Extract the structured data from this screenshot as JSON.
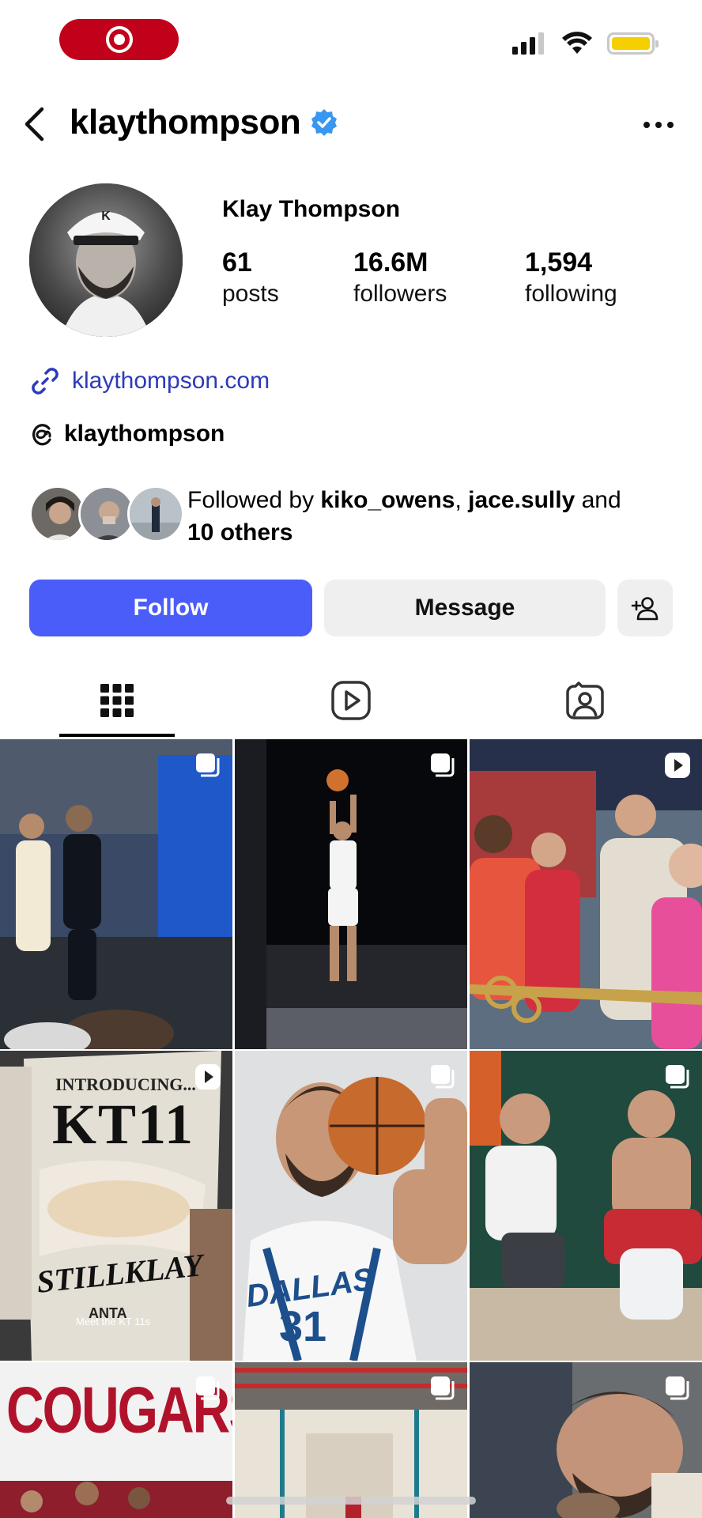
{
  "status_bar": {
    "icons": [
      "screen-record-icon",
      "signal-icon",
      "wifi-icon",
      "battery-icon"
    ]
  },
  "header": {
    "username": "klaythompson",
    "verified": true,
    "icons": [
      "back-icon",
      "verified-badge-icon",
      "more-icon"
    ]
  },
  "profile": {
    "display_name": "Klay Thompson",
    "stats": {
      "posts_count": "61",
      "posts_label": "posts",
      "followers_count": "16.6M",
      "followers_label": "followers",
      "following_count": "1,594",
      "following_label": "following"
    },
    "website": "klaythompson.com",
    "threads_handle": "klaythompson",
    "followed_by": {
      "prefix": "Followed by ",
      "user1": "kiko_owens",
      "sep": ", ",
      "user2": "jace.sully",
      "middle": " and",
      "others": "10 others"
    }
  },
  "actions": {
    "follow_label": "Follow",
    "message_label": "Message"
  },
  "tabs": [
    {
      "name": "posts",
      "icon": "grid-icon",
      "active": true
    },
    {
      "name": "reels",
      "icon": "reels-icon",
      "active": false
    },
    {
      "name": "tagged",
      "icon": "tagged-icon",
      "active": false
    }
  ],
  "grid": {
    "posts": [
      {
        "type": "carousel"
      },
      {
        "type": "carousel"
      },
      {
        "type": "video"
      },
      {
        "type": "video",
        "overlay_text": [
          "INTRODUCING...",
          "KT11",
          "STILLKLAY",
          "ANTA"
        ],
        "caption": "Meet the KT 11s"
      },
      {
        "type": "carousel",
        "overlay_text": [
          "DALLAS",
          "31"
        ]
      },
      {
        "type": "carousel"
      },
      {
        "type": "carousel",
        "overlay_text": [
          "COUGARS"
        ]
      },
      {
        "type": "carousel"
      },
      {
        "type": "carousel"
      }
    ]
  },
  "colors": {
    "follow_button": "#4a5df9",
    "link": "#2d3ab8",
    "verified": "#3897f0",
    "record_pill": "#c1001a",
    "battery": "#f5cf00"
  }
}
